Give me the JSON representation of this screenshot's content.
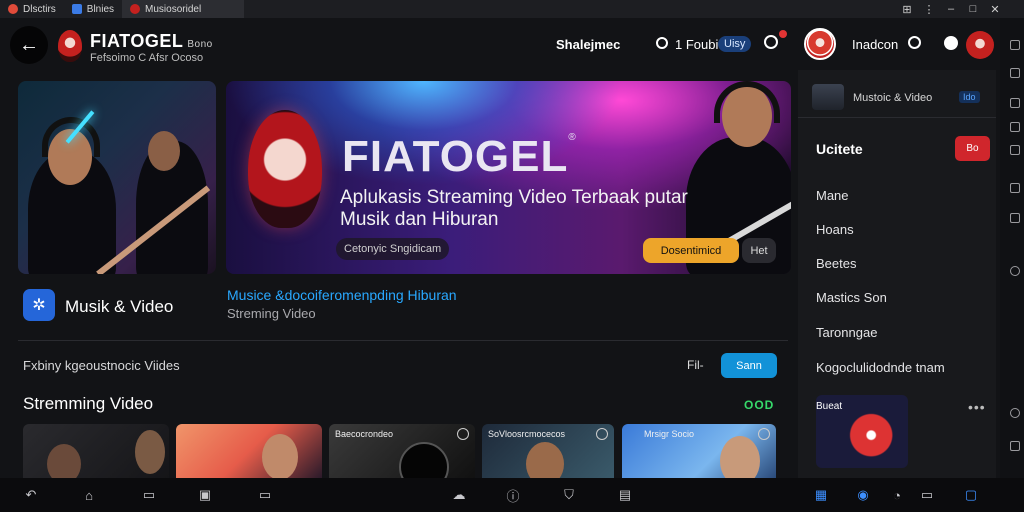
{
  "tabs": [
    {
      "label": "Dlsctirs",
      "color": "#e14b3a"
    },
    {
      "label": "Blnies",
      "color": "#3b7be6"
    },
    {
      "label": "Musiosoridel",
      "color": "#c4211f",
      "active": true
    }
  ],
  "header": {
    "title": "FIATOGEL",
    "title_suffix": "Bono",
    "subtitle": "Fefsoimo C Afsr Ocoso",
    "center_text": "Shalejmec",
    "login_text": "1 Foubi",
    "user_pill": "Uisy",
    "profile_label": "Inadcon"
  },
  "hero_left": {},
  "hero": {
    "title": "FIATOGEL",
    "reg_mark": "®",
    "subtitle": "Aplukasis Streaming Video Terbaak putar Musik dan Hiburan",
    "chip": "Cetonyic Sngidicam",
    "primary_button": "Dosentimicd",
    "secondary_button": "Het"
  },
  "category": {
    "label": "Musik & Video",
    "link": "Musice &docoiferomenpding Hiburan",
    "meta": "Streming Video"
  },
  "section1": {
    "title": "Fxbiny kgeoustnocic Viides",
    "right_text": "Fil-",
    "button": "Sann"
  },
  "section2": {
    "title": "Stremming Video",
    "badge": "OOD"
  },
  "thumbnails": [
    {
      "label": "",
      "bg": "linear-gradient(135deg,#2a2a2e,#151518)"
    },
    {
      "label": "",
      "bg": "linear-gradient(135deg,#f0956a,#e65c4a 50%,#2a1a2a)"
    },
    {
      "label": "Baecocrondeo",
      "bg": "linear-gradient(135deg,#3a3a3a,#111)"
    },
    {
      "label": "SoVloosrcmocecos",
      "bg": "linear-gradient(135deg,#1e2a3a,#3a5a6a)"
    },
    {
      "label": "Mrsigr Socio",
      "bg": "linear-gradient(135deg,#3a7ad8,#7ab6ee 60%,#2a4a7a)"
    }
  ],
  "right_panel": {
    "top_label": "Mustoic & Video",
    "top_badge": "Ido",
    "heading": "Ucitete",
    "heading_badge": "Bo",
    "items": [
      "Mane",
      "Hoans",
      "Beetes",
      "Mastics Son",
      "Taronngae",
      "Kogoclulidodnde tnam"
    ],
    "card_label": "Bueat",
    "more": "•••"
  },
  "colors": {
    "background": "#121316",
    "accent_blue": "#1292d8",
    "accent_orange": "#eda52a",
    "accent_red": "#d0262c",
    "accent_green": "#36d96a"
  }
}
